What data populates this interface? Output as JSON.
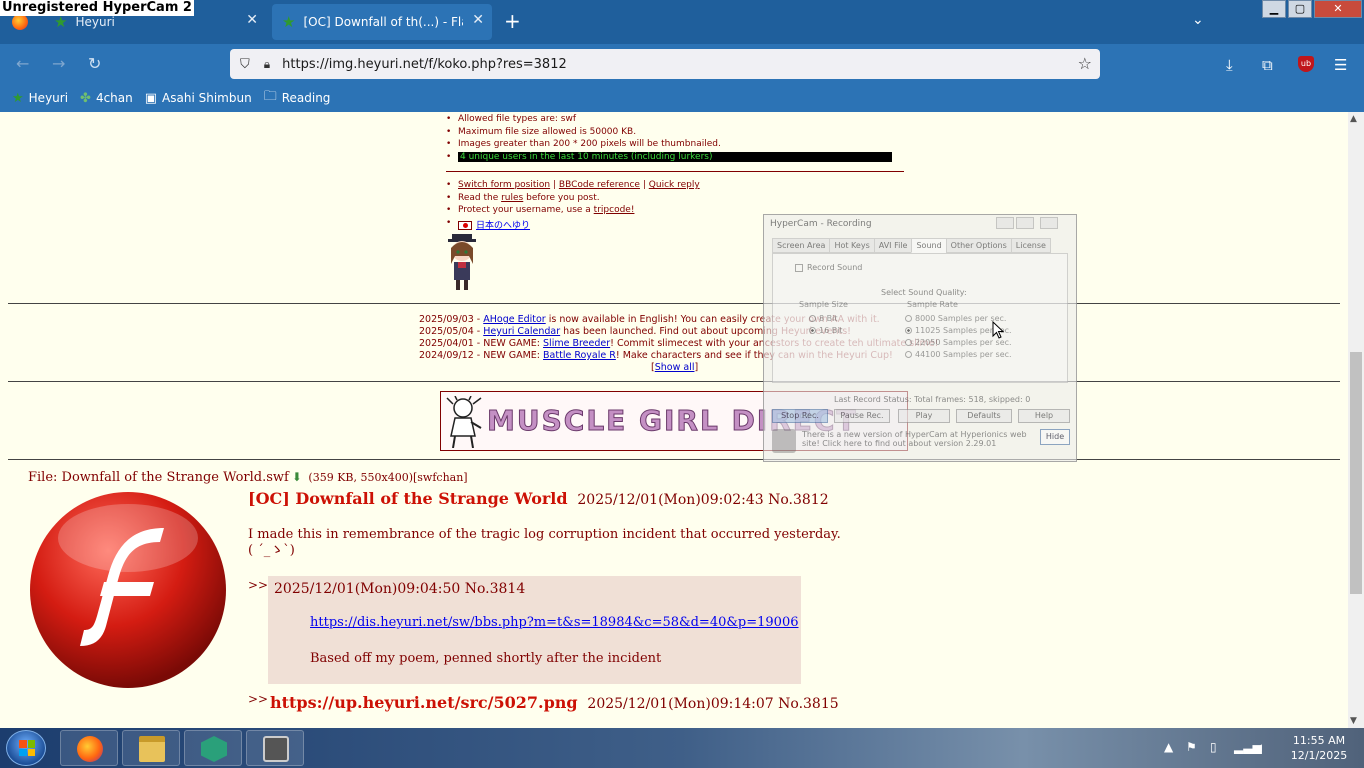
{
  "watermark": "Unregistered HyperCam 2",
  "browser": {
    "tabs": [
      {
        "label": "Heyuri"
      },
      {
        "label": "[OC] Downfall of th(...) - Flash"
      }
    ],
    "url": "https://img.heyuri.net/f/koko.php?res=3812",
    "bookmarks": [
      "Heyuri",
      "4chan",
      "Asahi Shimbun",
      "Reading"
    ]
  },
  "rules": {
    "items": [
      "Allowed file types are: swf",
      "Maximum file size allowed is 50000 KB.",
      "Images greater than 200 * 200 pixels will be thumbnailed."
    ],
    "users": "4 unique users in the last 10 minutes (including lurkers)",
    "switch_form": "Switch form position",
    "sep": "|",
    "bbcode": "BBCode reference",
    "quick_reply": "Quick reply",
    "read_pre": "Read the ",
    "read_link": "rules",
    "read_post": " before you post.",
    "protect_pre": "Protect your username, use a ",
    "protect_link": "tripcode!",
    "jp_link": "日本のへゆり"
  },
  "news": [
    {
      "date": "2025/09/03 - ",
      "link": "AHoge Editor",
      "text": " is now available in English! You can easily create your own AA with it."
    },
    {
      "date": "2025/05/04 - ",
      "link": "Heyuri Calendar",
      "text": " has been launched. Find out about upcoming Heyuri events!"
    },
    {
      "date": "2025/04/01 - NEW GAME: ",
      "link": "Slime Breeder",
      "text": "! Commit slimecest with your ancestors to create teh ultimate slime!"
    },
    {
      "date": "2024/09/12 - NEW GAME: ",
      "link": "Battle Royale R",
      "text": "! Make characters and see if they can win the Heyuri Cup!"
    }
  ],
  "show_all": "Show all",
  "bracket_open": "[",
  "bracket_close": "]",
  "banner_text": "MUSCLE GIRL DIRECT",
  "post": {
    "file_label": "File: ",
    "file_name": "Downfall of the Strange World.swf",
    "file_meta": " (359 KB, 550x400)[swfchan]",
    "title": "[OC] Downfall of the Strange World",
    "date": "2025/12/01(Mon)09:02:43 No.3812",
    "body_line1": "I made this in remembrance of the tragic log corruption incident that occurred yesterday.",
    "body_line2": "( ´_ゝ`)"
  },
  "replies": [
    {
      "marker": ">>",
      "date": "2025/12/01(Mon)09:04:50 No.3814",
      "link": "https://dis.heyuri.net/sw/bbs.php?m=t&s=18984&c=58&d=40&p=19006",
      "text": "Based off my poem, penned shortly after the incident"
    },
    {
      "marker": ">>",
      "title": "https://up.heyuri.net/src/5027.png",
      "date": "2025/12/01(Mon)09:14:07 No.3815"
    }
  ],
  "hypercam": {
    "title": "HyperCam - Recording",
    "tabs": [
      "Screen Area",
      "Hot Keys",
      "AVI File",
      "Sound",
      "Other Options",
      "License"
    ],
    "record_sound": "Record Sound",
    "select_quality": "Select Sound Quality:",
    "sample_size": "Sample Size",
    "sample_rate": "Sample Rate",
    "sizes": [
      "8 Bit",
      "16 Bit"
    ],
    "rates": [
      "8000 Samples per sec.",
      "11025 Samples per sec.",
      "22050 Samples per sec.",
      "44100 Samples per sec."
    ],
    "status": "Last Record Status: Total frames: 518, skipped: 0",
    "buttons": [
      "Stop Rec.",
      "Pause Rec.",
      "Play",
      "Defaults",
      "Help"
    ],
    "note": "There is a new version of HyperCam at Hyperionics web site! Click here to find out about version 2.29.01",
    "hide": "Hide"
  },
  "clock": {
    "time": "11:55 AM",
    "date": "12/1/2025"
  }
}
